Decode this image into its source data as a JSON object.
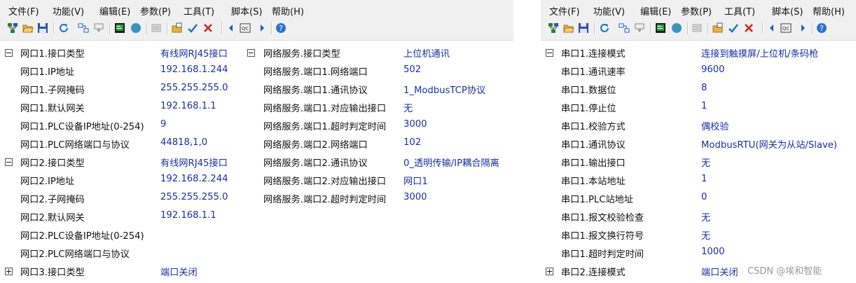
{
  "menu": [
    "文件(F)",
    "功能(V)",
    "编辑(E)",
    "参数(P)",
    "工具(T)",
    "脚本(S)",
    "帮助(H)"
  ],
  "toolbar_icons": [
    "network-scan-icon",
    "open-folder-icon",
    "save-icon",
    "refresh-icon",
    "link-icon",
    "download-icon",
    "terminal-icon",
    "globe-icon",
    "disabled-icon",
    "open-file-icon",
    "check-icon",
    "close-icon",
    "prev-icon",
    "qc-icon",
    "next-icon",
    "help-icon"
  ],
  "panel1": {
    "col1": [
      {
        "label": "网口1.接口类型",
        "value": "有线网RJ45接口",
        "toggle": "minus"
      },
      {
        "label": "网口1.IP地址",
        "value": "192.168.1.244"
      },
      {
        "label": "网口1.子网掩码",
        "value": "255.255.255.0"
      },
      {
        "label": "网口1.默认网关",
        "value": "192.168.1.1"
      },
      {
        "label": "网口1.PLC设备IP地址(0-254)",
        "value": "9"
      },
      {
        "label": "网口1.PLC网络端口与协议",
        "value": "44818,1,0"
      },
      {
        "label": "网口2.接口类型",
        "value": "有线网RJ45接口",
        "toggle": "minus"
      },
      {
        "label": "网口2.IP地址",
        "value": "192.168.2.244"
      },
      {
        "label": "网口2.子网掩码",
        "value": "255.255.255.0"
      },
      {
        "label": "网口2.默认网关",
        "value": "192.168.1.1"
      },
      {
        "label": "网口2.PLC设备IP地址(0-254)",
        "value": ""
      },
      {
        "label": "网口2.PLC网络端口与协议",
        "value": ""
      },
      {
        "label": "网口3.接口类型",
        "value": "端口关闭",
        "toggle": "plus"
      }
    ],
    "col2": [
      {
        "label": "网络服务.接口类型",
        "value": "上位机通讯",
        "toggle": "minus"
      },
      {
        "label": "网络服务.端口1.网络端口",
        "value": "502"
      },
      {
        "label": "网络服务.端口1.通讯协议",
        "value": "1_ModbusTCP协议"
      },
      {
        "label": "网络服务.端口1.对应输出接口",
        "value": "无"
      },
      {
        "label": "网络服务.端口1.超时判定时间",
        "value": "3000"
      },
      {
        "label": "网络服务.端口2.网络端口",
        "value": "102"
      },
      {
        "label": "网络服务.端口2.通讯协议",
        "value": "0_透明传输/IP耦合隔离"
      },
      {
        "label": "网络服务.端口2.对应输出接口",
        "value": "网口1"
      },
      {
        "label": "网络服务.端口2.超时判定时间",
        "value": "3000"
      }
    ]
  },
  "panel2": {
    "rows": [
      {
        "label": "串口1.连接模式",
        "value": "连接到触摸屏/上位机/条码枪",
        "toggle": "minus"
      },
      {
        "label": "串口1.通讯速率",
        "value": "9600"
      },
      {
        "label": "串口1.数据位",
        "value": "8"
      },
      {
        "label": "串口1.停止位",
        "value": "1"
      },
      {
        "label": "串口1.校验方式",
        "value": "偶校验"
      },
      {
        "label": "串口1.通讯协议",
        "value": "ModbusRTU(网关为从站/Slave)"
      },
      {
        "label": "串口1.输出接口",
        "value": "无"
      },
      {
        "label": "串口1.本站地址",
        "value": "1"
      },
      {
        "label": "串口1.PLC站地址",
        "value": "0"
      },
      {
        "label": "串口1.报文校验检查",
        "value": "无"
      },
      {
        "label": "串口1.报文换行符号",
        "value": "无"
      },
      {
        "label": "串口1.超时判定时间",
        "value": "1000"
      },
      {
        "label": "串口2.连接模式",
        "value": "端口关闭",
        "toggle": "plus"
      }
    ],
    "watermark": "CSDN @埃和智能"
  }
}
